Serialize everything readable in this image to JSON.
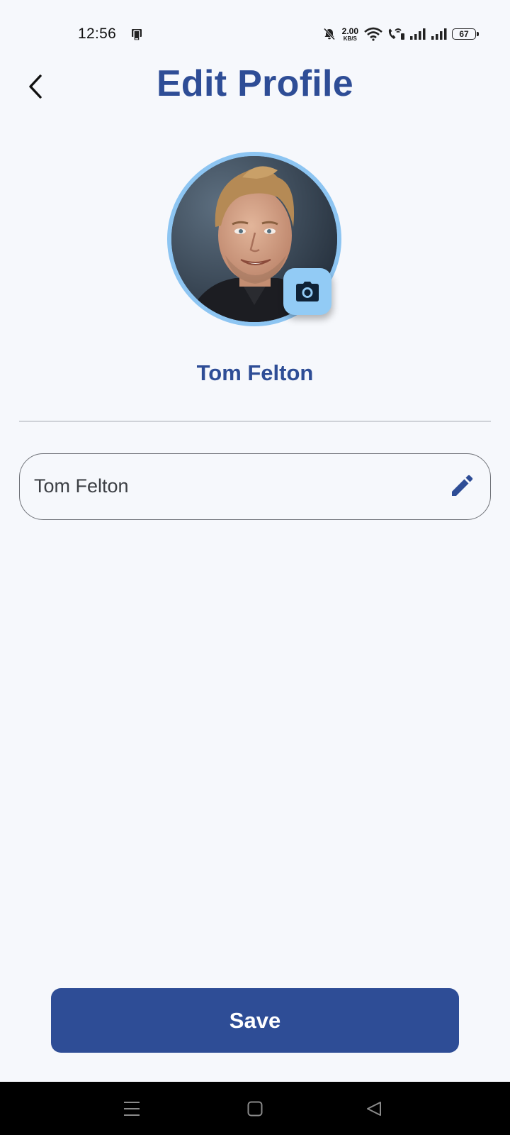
{
  "status_bar": {
    "time": "12:56",
    "net_speed_value": "2.00",
    "net_speed_unit": "KB/S",
    "battery": "67",
    "icons": [
      "phone-device-icon",
      "bell-muted-icon",
      "wifi-icon",
      "wifi-call-icon",
      "signal-icon",
      "signal-icon",
      "battery-icon"
    ]
  },
  "header": {
    "title": "Edit Profile",
    "back_icon": "chevron-left-icon"
  },
  "profile": {
    "display_name": "Tom Felton",
    "avatar_ring_color": "#8dc5f2",
    "camera_icon": "camera-icon"
  },
  "form": {
    "name_value": "Tom Felton",
    "edit_icon": "pencil-icon"
  },
  "actions": {
    "save_label": "Save"
  },
  "nav_bar": {
    "items": [
      "menu-icon",
      "home-icon",
      "back-triangle-icon"
    ]
  },
  "colors": {
    "accent": "#2e4d96",
    "background": "#f6f8fc",
    "avatar_ring": "#8dc5f2",
    "camera_button": "#92cbf5"
  }
}
